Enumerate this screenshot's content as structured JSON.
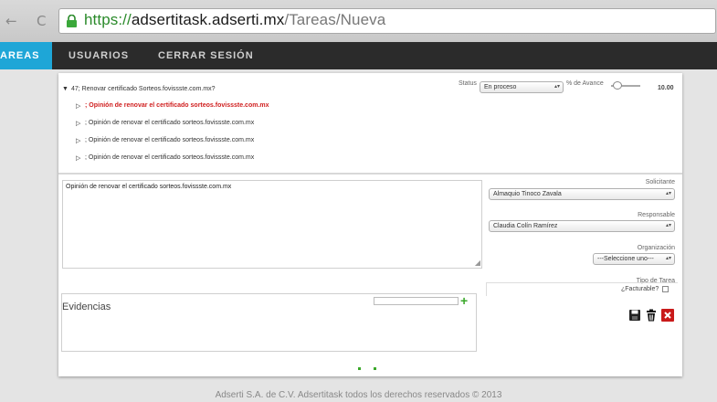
{
  "browser": {
    "url_scheme": "https://",
    "url_host": "adsertitask.adserti.mx",
    "url_path": "/Tareas/Nueva",
    "back_glyph": "←",
    "reload_glyph": "C"
  },
  "nav": {
    "tabs": [
      {
        "label": "AREAS",
        "active": true
      },
      {
        "label": "USUARIOS",
        "active": false
      },
      {
        "label": "CERRAR SESIÓN",
        "active": false
      }
    ]
  },
  "tree": {
    "root": "47; Renovar certificado Sorteos.fovissste.com.mx?",
    "children": [
      "; Opinión de renovar el certificado sorteos.fovissste.com.mx",
      "; Opinión de renovar el certificado sorteos.fovissste.com.mx",
      "; Opinión de renovar el certificado sorteos.fovissste.com.mx",
      "; Opinión de renovar el certificado sorteos.fovissste.com.mx"
    ]
  },
  "status": {
    "label": "Status",
    "value": "En proceso"
  },
  "progress": {
    "label": "% de Avance",
    "value": "10.00",
    "fraction": 0.1
  },
  "description": "Opinión de renovar el certificado sorteos.fovissste.com.mx",
  "form": {
    "solicitante_label": "Solicitante",
    "solicitante_value": "Almaquio Tinoco Zavala",
    "responsable_label": "Responsable",
    "responsable_value": "Claudia Colín Ramírez",
    "organizacion_label": "Organización",
    "organizacion_value": "---Seleccione uno---",
    "tipo_label": "Tipo de Tarea",
    "facturable_label": "¿Facturable?"
  },
  "evidencias": {
    "title": "Evidencias"
  },
  "icons": {
    "save": "save-icon",
    "delete": "trash-icon",
    "close": "close-icon",
    "add": "plus-icon"
  },
  "colors": {
    "accent": "#1ea6d7",
    "danger": "#d02020",
    "add": "#3aa82a"
  },
  "footer": "Adserti S.A. de C.V. Adsertitask todos los derechos reservados © 2013"
}
